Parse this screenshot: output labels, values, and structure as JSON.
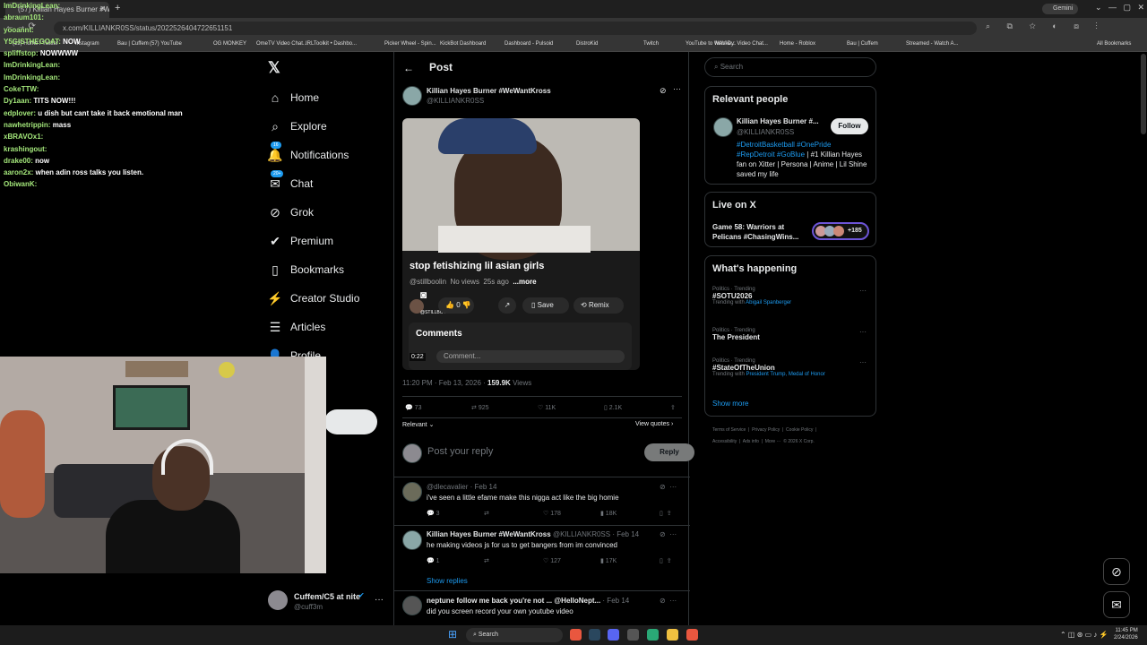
{
  "browser": {
    "tab_title": "(57) Killian Hayes Burner #We",
    "url": "x.com/KILLIANKR0SS/status/2022526404722651151",
    "gemini_label": "Gemini",
    "bookmarks": [
      "(12) Home / Twitter",
      "Instagram",
      "Bau | Cuffem",
      "(57) YouTube",
      "OG MONKEY",
      "OmeTV Video Chat...",
      "IRLToolkit • Dashbo...",
      "Picker Wheel - Spin...",
      "KickBot Dashboard",
      "Dashboard - Pulsoid",
      "DistroKid",
      "Twitch",
      "YouTube to WAV D...",
      "Monkey: Video Chat...",
      "Home - Roblox",
      "Bau | Cuffem",
      "Streamed - Watch A..."
    ],
    "all_bookmarks": "All Bookmarks"
  },
  "stream_chat": [
    {
      "user": "ImDrinkingLean:",
      "msg": ""
    },
    {
      "user": "abraum101:",
      "msg": ""
    },
    {
      "user": "yooannt:",
      "msg": ""
    },
    {
      "user": "Y5GISTHEGOAT:",
      "msg": "NOW"
    },
    {
      "user": "spliffstop:",
      "msg": "NOWWWW"
    },
    {
      "user": "ImDrinkingLean:",
      "msg": ""
    },
    {
      "user": "ImDrinkingLean:",
      "msg": ""
    },
    {
      "user": "CokeTTW:",
      "msg": ""
    },
    {
      "user": "Dy1aan:",
      "msg": "TITS NOW!!!"
    },
    {
      "user": "edplover:",
      "msg": "u dish but cant take it back emotional man"
    },
    {
      "user": "nawhetrippin:",
      "msg": "mass"
    },
    {
      "user": "xBRAVOx1:",
      "msg": ""
    },
    {
      "user": "krashingout:",
      "msg": ""
    },
    {
      "user": "drake00:",
      "msg": "now"
    },
    {
      "user": "aaron2x:",
      "msg": "when adin ross talks you listen."
    },
    {
      "user": "ObiwanK:",
      "msg": ""
    }
  ],
  "nav": {
    "items": [
      {
        "label": "Home",
        "icon": "home-icon"
      },
      {
        "label": "Explore",
        "icon": "search-icon"
      },
      {
        "label": "Notifications",
        "icon": "bell-icon",
        "badge": "16"
      },
      {
        "label": "Chat",
        "icon": "mail-icon",
        "badge": "20+"
      },
      {
        "label": "Grok",
        "icon": "grok-icon"
      },
      {
        "label": "Premium",
        "icon": "verified-icon"
      },
      {
        "label": "Bookmarks",
        "icon": "bookmark-icon"
      },
      {
        "label": "Creator Studio",
        "icon": "creator-icon"
      },
      {
        "label": "Articles",
        "icon": "articles-icon"
      },
      {
        "label": "Profile",
        "icon": "profile-icon"
      }
    ],
    "account_name": "Cuffem/C5 at nite",
    "account_handle": "@cuff3m"
  },
  "post": {
    "header_title": "Post",
    "author_name": "Killian Hayes Burner #WeWantKross",
    "author_handle": "@KILLIANKR0SS",
    "video": {
      "title": "stop fetishizing lil asian girls",
      "channel": "@stillboolin",
      "views": "No views",
      "ago": "25s ago",
      "more": "...more",
      "likes": "0",
      "save": "Save",
      "remix": "Remix",
      "watermark": "@STILLBOOLIN",
      "comments_label": "Comments",
      "comment_placeholder": "Comment...",
      "time": "0:22"
    },
    "timestamp": "11:20 PM · Feb 13, 2026 ·",
    "views_count": "159.9K",
    "views_label": "Views",
    "replies": "73",
    "reposts": "925",
    "likes": "11K",
    "bookmarks": "2.1K",
    "relevant": "Relevant",
    "view_quotes": "View quotes",
    "reply_placeholder": "Post your reply",
    "reply_button": "Reply"
  },
  "replies": [
    {
      "name": "",
      "handle": "@dlecavalier",
      "date": "· Feb 14",
      "text": "i've seen a little efame make this nigga act like the big homie",
      "replies": "3",
      "likes": "178",
      "views": "18K"
    },
    {
      "name": "Killian Hayes Burner #WeWantKross",
      "handle": "@KILLIANKR0SS · Feb 14",
      "date": "",
      "text": "he making videos js for us to get bangers from im convinced",
      "replies": "1",
      "likes": "127",
      "views": "17K"
    },
    {
      "name": "neptune",
      "handle": "follow me back you're not ... @HelloNept...",
      "date": "· Feb 14",
      "text": "did you screen record your own youtube video"
    }
  ],
  "show_replies": "Show replies",
  "sidebar": {
    "search_placeholder": "Search",
    "relevant_people_title": "Relevant people",
    "person_name": "Killian Hayes Burner #...",
    "person_handle": "@KILLIANKR0SS",
    "follow_label": "Follow",
    "bio_tags": "#DetroitBasketball",
    "bio_tags2": "#OnePride",
    "bio_tags3": "#RepDetroit #GoBlue",
    "bio_text": "| #1 Killian Hayes fan on Xitter | Persona | Anime | Lil Shine saved my life",
    "live_title": "Live on X",
    "live_event": "Game 58: Warriors at Pelicans #ChasingWins...",
    "live_count": "+185",
    "happening_title": "What's happening",
    "trends": [
      {
        "cat": "Politics · Trending",
        "title": "#SOTU2026",
        "with": "Trending with",
        "withlinks": "Abigail Spanberger"
      },
      {
        "cat": "Politics · Trending",
        "title": "The President",
        "with": "",
        "withlinks": ""
      },
      {
        "cat": "Politics · Trending",
        "title": "#StateOfTheUnion",
        "with": "Trending with",
        "withlinks": "President Trump, Medal of Honor"
      }
    ],
    "show_more": "Show more",
    "footer1": "Terms of Service  |  Privacy Policy  |  Cookie Policy  |",
    "footer2": "Accessibility  |  Ads info  |  More ···  © 2026 X Corp."
  },
  "taskbar": {
    "search": "Search",
    "time": "11:45 PM",
    "date": "2/24/2026"
  },
  "colors": {
    "accent": "#1d9bf0",
    "chat_name": "#a3e67a",
    "bg": "#000000"
  }
}
